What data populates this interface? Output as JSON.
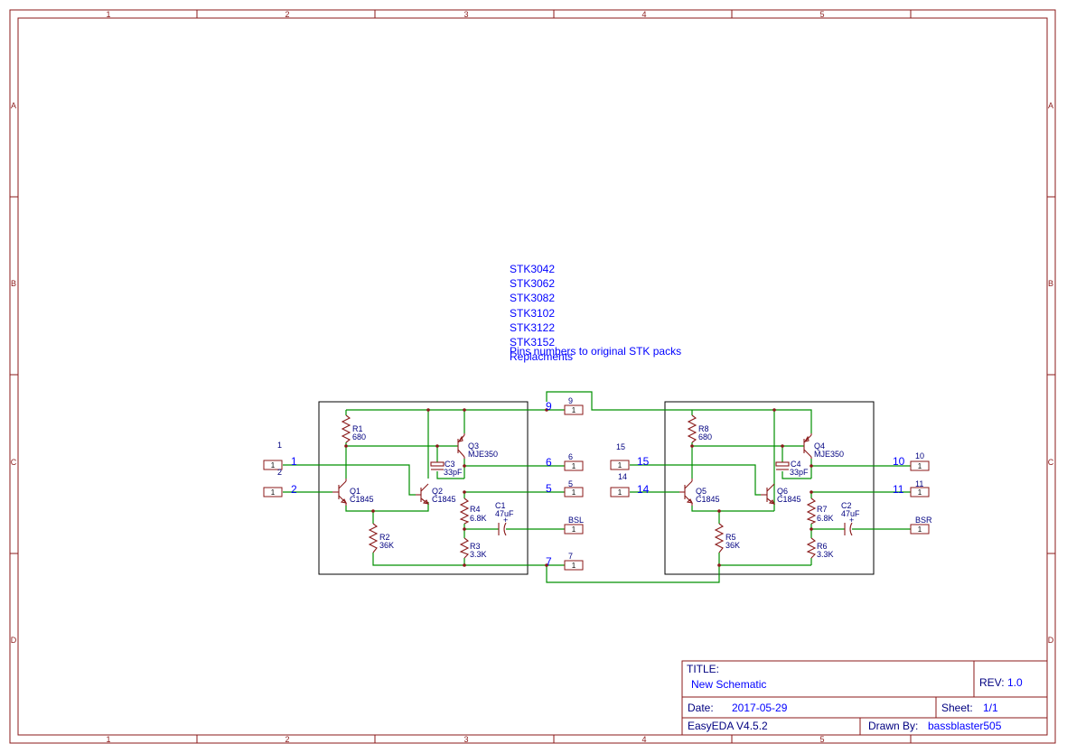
{
  "zones": {
    "columns": [
      "1",
      "2",
      "3",
      "4",
      "5"
    ],
    "rows": [
      "A",
      "B",
      "C",
      "D"
    ]
  },
  "notes": {
    "stk_lines": [
      "STK3042",
      "STK3062",
      "STK3082",
      "STK3102",
      "STK3122",
      "STK3152"
    ],
    "pins_note": "Pins numbers to original STK packs",
    "replacements": "Replacments"
  },
  "left_channel": {
    "input_nets": [
      "1",
      "2"
    ],
    "input_labels": [
      "1",
      "2"
    ],
    "transistors": [
      {
        "ref": "Q1",
        "value": "C1845"
      },
      {
        "ref": "Q2",
        "value": "C1845"
      },
      {
        "ref": "Q3",
        "value": "MJE350"
      }
    ],
    "resistors": [
      {
        "ref": "R1",
        "value": "680"
      },
      {
        "ref": "R2",
        "value": "36K"
      },
      {
        "ref": "R3",
        "value": "3.3K"
      },
      {
        "ref": "R4",
        "value": "6.8K"
      }
    ],
    "capacitors": [
      {
        "ref": "C1",
        "value": "47uF"
      },
      {
        "ref": "C3",
        "value": "33pF"
      }
    ],
    "output_nets": [
      "9",
      "6",
      "5",
      "7"
    ],
    "output_labels": [
      "9",
      "6",
      "5",
      "BSL",
      "7"
    ]
  },
  "right_channel": {
    "input_nets": [
      "15",
      "14"
    ],
    "input_labels": [
      "15",
      "14"
    ],
    "transistors": [
      {
        "ref": "Q5",
        "value": "C1845"
      },
      {
        "ref": "Q6",
        "value": "C1845"
      },
      {
        "ref": "Q4",
        "value": "MJE350"
      }
    ],
    "resistors": [
      {
        "ref": "R8",
        "value": "680"
      },
      {
        "ref": "R5",
        "value": "36K"
      },
      {
        "ref": "R6",
        "value": "3.3K"
      },
      {
        "ref": "R7",
        "value": "6.8K"
      }
    ],
    "capacitors": [
      {
        "ref": "C2",
        "value": "47uF"
      },
      {
        "ref": "C4",
        "value": "33pF"
      }
    ],
    "output_nets": [
      "10",
      "11"
    ],
    "output_labels": [
      "10",
      "11",
      "BSR"
    ]
  },
  "connector_pin": "1",
  "title_block": {
    "title_label": "TITLE:",
    "title_value": "New Schematic",
    "rev_label": "REV:",
    "rev_value": "1.0",
    "date_label": "Date:",
    "date_value": "2017-05-29",
    "sheet_label": "Sheet:",
    "sheet_value": "1/1",
    "tool": "EasyEDA V4.5.2",
    "drawn_label": "Drawn By:",
    "drawn_value": "bassblaster505"
  },
  "colors": {
    "frame": "#8b1a1a",
    "wire": "#009000",
    "label": "#000080",
    "net": "#0000ff"
  }
}
